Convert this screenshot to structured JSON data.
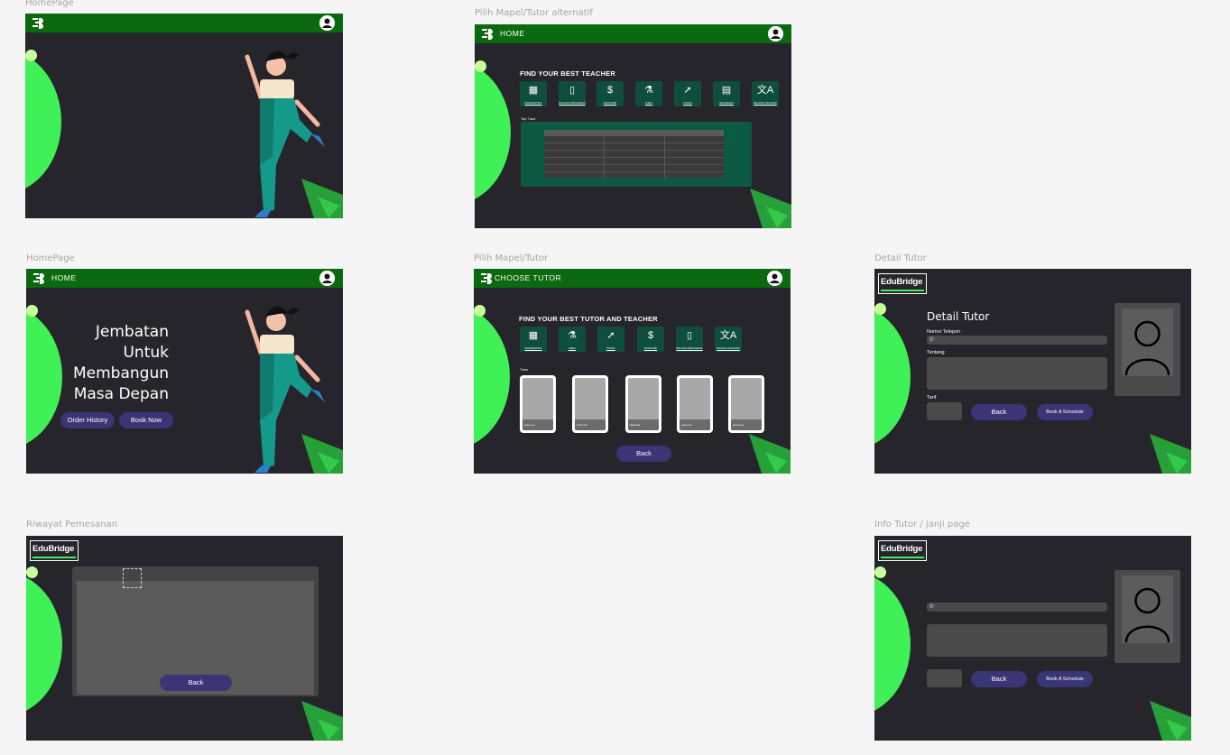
{
  "frames": {
    "home1": {
      "label": "HomePage"
    },
    "alt": {
      "label": "Pilih Mapel/Tutor alternatif",
      "title": "HOME",
      "heading": "FIND YOUR BEST TEACHER",
      "table_label": "Top Tutor",
      "subjects": [
        {
          "icon": "calculator-icon",
          "glyph": "▦",
          "label": "MATEMATIKA"
        },
        {
          "icon": "book-icon",
          "glyph": "▯",
          "label": "BAHASA INDONESIA"
        },
        {
          "icon": "dollar-icon",
          "glyph": "$",
          "label": "EKONOMI"
        },
        {
          "icon": "flask-icon",
          "glyph": "⚗",
          "label": "KIMIA"
        },
        {
          "icon": "rocket-icon",
          "glyph": "➚",
          "label": "FISIKA"
        },
        {
          "icon": "map-icon",
          "glyph": "▤",
          "label": "GEOGRAFI"
        },
        {
          "icon": "translate-icon",
          "glyph": "文A",
          "label": "BAHASA INGGRIS"
        }
      ]
    },
    "home2": {
      "label": "HomePage",
      "title": "HOME",
      "hero_lines": [
        "Jembatan",
        "Untuk",
        "Membangun",
        "Masa Depan"
      ],
      "order_history": "Order History",
      "book_now": "Book Now"
    },
    "choose": {
      "label": "Pilih Mapel/Tutor",
      "title": "CHOOSE TUTOR",
      "heading": "FIND YOUR BEST TUTOR AND TEACHER",
      "tutor_label": "Tutor",
      "subjects": [
        {
          "icon": "calculator-icon",
          "glyph": "▦",
          "label": "MATEMATIKA"
        },
        {
          "icon": "flask-icon",
          "glyph": "⚗",
          "label": "KIMIA"
        },
        {
          "icon": "rocket-icon",
          "glyph": "➚",
          "label": "FISIKA"
        },
        {
          "icon": "dollar-icon",
          "glyph": "$",
          "label": "EKONOMI"
        },
        {
          "icon": "book-icon",
          "glyph": "▯",
          "label": "BAHASA INDONESIA"
        },
        {
          "icon": "translate-icon",
          "glyph": "文A",
          "label": "BAHASA INGGRIS"
        }
      ],
      "tutors": [
        "Lulu Lua",
        "Lulu Lua",
        "Marisela",
        "Lulu Lua",
        "Hani Lua"
      ],
      "back": "Back"
    },
    "detail": {
      "label": "Detail Tutor",
      "brand": "EduBridge",
      "heading": "Detail Tutor",
      "phone_label": "Nomor Telepon",
      "about_label": "Tentang",
      "rate_label": "Tarif",
      "back": "Back",
      "book": "Book A Schedule"
    },
    "history": {
      "label": "Riwayat Pemesanan",
      "brand": "EduBridge",
      "back": "Back"
    },
    "info": {
      "label": "Info Tutor / janji page",
      "brand": "EduBridge",
      "back": "Back",
      "book": "Book A Schedule"
    }
  },
  "colors": {
    "canvas": "#f5f5f5",
    "frame_bg": "#26252b",
    "topbar": "#0b6a0f",
    "accent_green": "#3ff057",
    "pill": "#3a3576",
    "panel_green": "#0c5a42"
  }
}
